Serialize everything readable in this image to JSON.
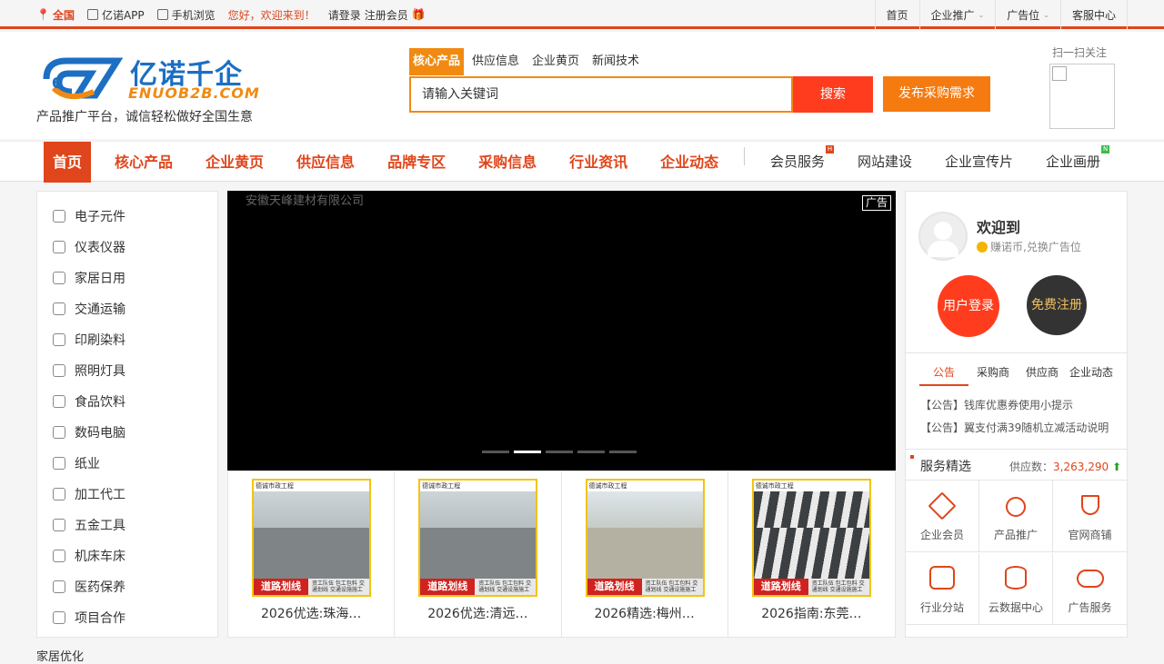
{
  "topbar": {
    "location": "全国",
    "app": "亿诺APP",
    "mobile": "手机浏览",
    "welcome": "您好，欢迎来到！",
    "login": "请登录",
    "register": "注册会员",
    "right_links": [
      "首页",
      "企业推广",
      "广告位",
      "客服中心"
    ]
  },
  "header": {
    "logo_cn": "亿诺千企",
    "logo_en": "ENUOB2B.COM",
    "slogan": "产品推广平台，诚信轻松做好全国生意",
    "search_tabs": [
      "核心产品",
      "供应信息",
      "企业黄页",
      "新闻技术"
    ],
    "search_placeholder": "请输入关键词",
    "search_button": "搜索",
    "publish_button": "发布采购需求",
    "qr_text": "扫一扫关注"
  },
  "nav": {
    "main": [
      "首页",
      "核心产品",
      "企业黄页",
      "供应信息",
      "品牌专区",
      "采购信息",
      "行业资讯",
      "企业动态"
    ],
    "sub": [
      {
        "label": "会员服务",
        "badge": "H"
      },
      {
        "label": "网站建设",
        "badge": ""
      },
      {
        "label": "企业宣传片",
        "badge": ""
      },
      {
        "label": "企业画册",
        "badge": "N"
      }
    ]
  },
  "categories": [
    "电子元件",
    "仪表仪器",
    "家居日用",
    "交通运输",
    "印刷染料",
    "照明灯具",
    "食品饮料",
    "数码电脑",
    "纸业",
    "加工代工",
    "五金工具",
    "机床车床",
    "医药保养",
    "项目合作"
  ],
  "banner": {
    "alt": "安徽天峰建材有限公司",
    "ad_label": "广告",
    "slides": 5,
    "active_slide": 2
  },
  "products": [
    {
      "title": "2026优选:珠海…",
      "tag": "道路划线",
      "brand": "德诚市政工程",
      "note": "资工队伍 包工包料 交通划线 交通设施施工"
    },
    {
      "title": "2026优选:清远…",
      "tag": "道路划线",
      "brand": "德诚市政工程",
      "note": "资工队伍 包工包料 交通划线 交通设施施工"
    },
    {
      "title": "2026精选:梅州…",
      "tag": "道路划线",
      "brand": "德诚市政工程",
      "note": "资工队伍 包工包料 交通划线 交通设施施工"
    },
    {
      "title": "2026指南:东莞…",
      "tag": "道路划线",
      "brand": "德诚市政工程",
      "note": "资工队伍 包工包料 交通划线 交通设施施工"
    }
  ],
  "user_panel": {
    "welcome": "欢迎到",
    "coin_text": "赚诺币,兑换广告位",
    "login_button": "用户登录",
    "register_button": "免费注册",
    "notice_tabs": [
      "公告",
      "采购商",
      "供应商",
      "企业动态"
    ],
    "notices": [
      "【公告】钱库优惠券使用小提示",
      "【公告】翼支付满39随机立减活动说明"
    ],
    "service_title": "服务精选",
    "supply_label": "供应数：",
    "supply_count": "3,263,290",
    "services": [
      "企业会员",
      "产品推广",
      "官网商铺",
      "行业分站",
      "云数据中心",
      "广告服务"
    ]
  },
  "bottom": {
    "partial": "家居优化"
  }
}
